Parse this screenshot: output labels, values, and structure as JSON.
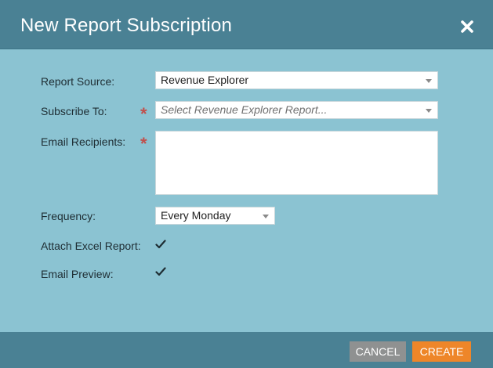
{
  "dialog": {
    "title": "New Report Subscription",
    "close_icon": "close-icon"
  },
  "form": {
    "report_source": {
      "label": "Report Source:",
      "value": "Revenue Explorer"
    },
    "subscribe_to": {
      "label": "Subscribe To:",
      "placeholder": "Select Revenue Explorer Report...",
      "required": "*"
    },
    "email_recipients": {
      "label": "Email Recipients:",
      "value": "",
      "required": "*"
    },
    "frequency": {
      "label": "Frequency:",
      "value": "Every Monday"
    },
    "attach_excel": {
      "label": "Attach Excel Report:",
      "checked": true
    },
    "email_preview": {
      "label": "Email Preview:",
      "checked": true
    }
  },
  "footer": {
    "cancel_label": "CANCEL",
    "create_label": "CREATE"
  },
  "colors": {
    "header": "#4a8194",
    "body": "#8bc3d2",
    "required": "#c0504d",
    "create_button": "#ee8629",
    "cancel_button": "#8f9191"
  }
}
